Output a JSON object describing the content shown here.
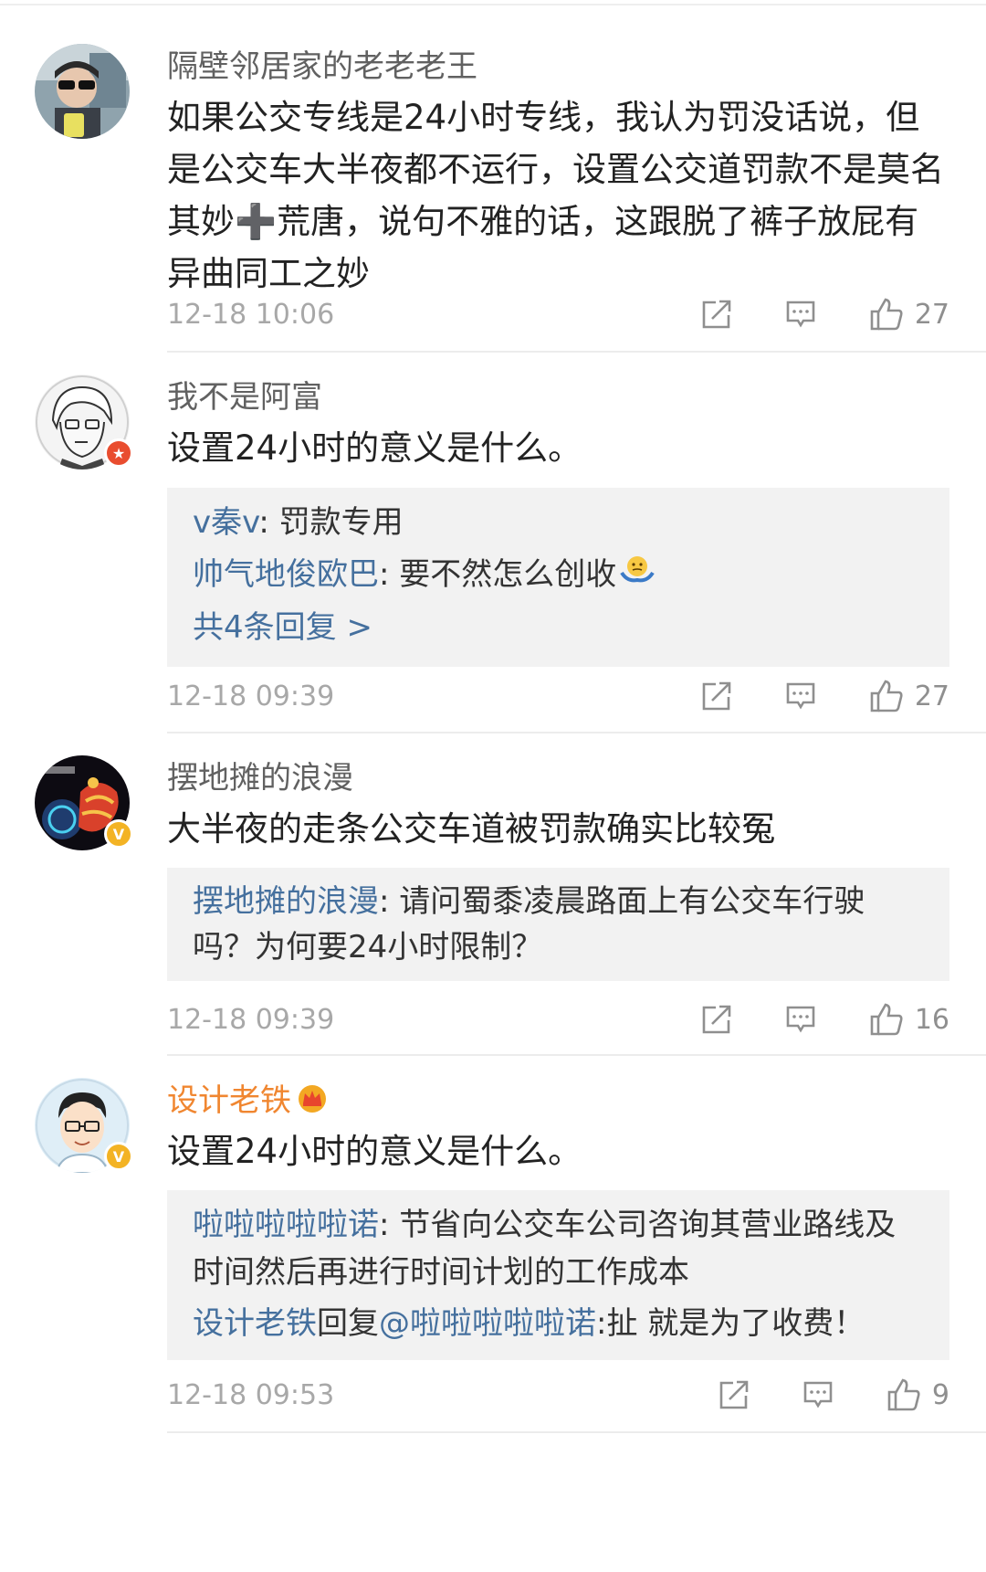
{
  "comments": [
    {
      "name": "隔壁邻居家的老老老王",
      "text": "如果公交专线是24小时专线，我认为罚没话说，但是公交车大半夜都不运行，设置公交道罚款不是莫名其妙➕荒唐，说句不雅的话，这跟脱了裤子放屁有异曲同工之妙",
      "date": "12-18 10:06",
      "likes": "27"
    },
    {
      "name": "我不是阿富",
      "text": "设置24小时的意义是什么。",
      "replies": [
        {
          "user": "v秦v",
          "sep": ": ",
          "text": "罚款专用"
        },
        {
          "user": "帅气地俊欧巴",
          "sep": ": ",
          "text": "要不然怎么创收"
        }
      ],
      "more": "共4条回复 >",
      "date": "12-18 09:39",
      "likes": "27"
    },
    {
      "name": "摆地摊的浪漫",
      "text": "大半夜的走条公交车道被罚款确实比较冤",
      "replies": [
        {
          "user": "摆地摊的浪漫",
          "sep": ": ",
          "text": "请问蜀黍凌晨路面上有公交车行驶吗？为何要24小时限制？"
        }
      ],
      "date": "12-18 09:39",
      "likes": "16"
    },
    {
      "name": "设计老铁",
      "text": "设置24小时的意义是什么。",
      "replies": [
        {
          "user": "啦啦啦啦啦诺",
          "sep": ": ",
          "text": "节省向公交车公司咨询其营业路线及时间然后再进行时间计划的工作成本"
        }
      ],
      "reply_line": {
        "user": "设计老铁",
        "word": "回复",
        "mention": "@啦啦啦啦啦诺",
        "text": ":扯 就是为了收费！"
      },
      "date": "12-18 09:53",
      "likes": "9"
    }
  ],
  "icons": {
    "share": "share-icon",
    "comment": "comment-icon",
    "like": "thumbs-up-icon",
    "crown": "crown-icon",
    "shrug": "shrug-emoji"
  },
  "colors": {
    "link": "#45709e",
    "vip_name": "#f08630",
    "date": "#a8a8a8"
  }
}
